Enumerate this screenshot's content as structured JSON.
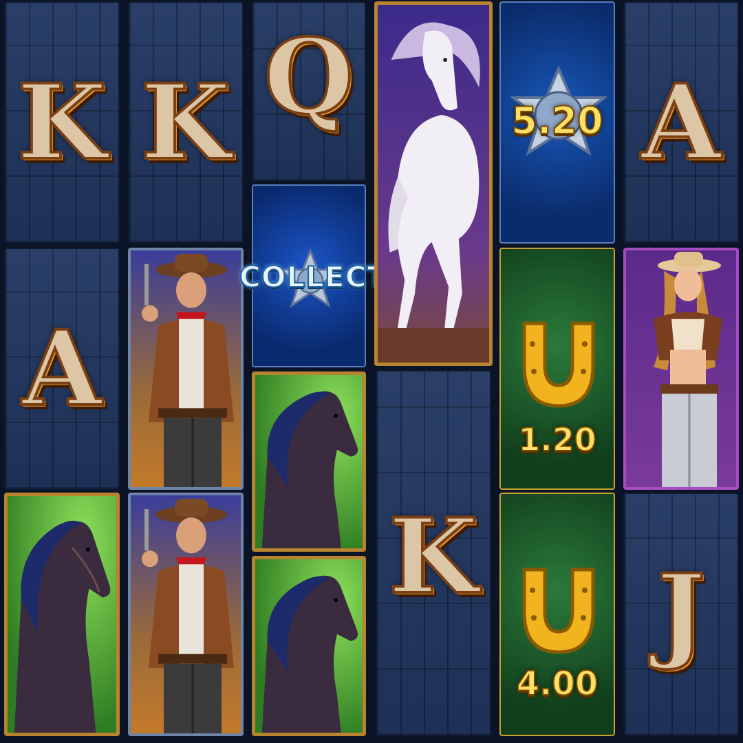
{
  "reels": [
    {
      "column": 1,
      "symbols": [
        {
          "type": "letter",
          "label": "K"
        },
        {
          "type": "letter",
          "label": "A"
        },
        {
          "type": "black-horse",
          "label": ""
        }
      ]
    },
    {
      "column": 2,
      "symbols": [
        {
          "type": "letter",
          "label": "K"
        },
        {
          "type": "cowboy",
          "label": ""
        },
        {
          "type": "cowboy",
          "label": ""
        }
      ]
    },
    {
      "column": 3,
      "symbols": [
        {
          "type": "letter",
          "label": "Q"
        },
        {
          "type": "collect",
          "label": "COLLECT"
        },
        {
          "type": "black-horse",
          "label": ""
        },
        {
          "type": "black-horse",
          "label": ""
        }
      ]
    },
    {
      "column": 4,
      "symbols": [
        {
          "type": "white-horse",
          "label": ""
        },
        {
          "type": "letter",
          "label": "K"
        }
      ]
    },
    {
      "column": 5,
      "symbols": [
        {
          "type": "sheriff-badge",
          "label": "5.20"
        },
        {
          "type": "horseshoe",
          "label": "1.20"
        },
        {
          "type": "horseshoe",
          "label": "4.00"
        }
      ]
    },
    {
      "column": 6,
      "symbols": [
        {
          "type": "letter",
          "label": "A"
        },
        {
          "type": "cowgirl",
          "label": ""
        },
        {
          "type": "letter",
          "label": "J"
        }
      ]
    }
  ],
  "colors": {
    "background": "#0b1426",
    "wood_panel": "#24375e",
    "letter_face": "#ddc6a6",
    "letter_edge": "#e7962e",
    "coin_value": "#ffe066",
    "horse_bg": "#4fa832",
    "coin_bg": "#1d5e2c",
    "badge_bg": "#0b3a8a"
  }
}
